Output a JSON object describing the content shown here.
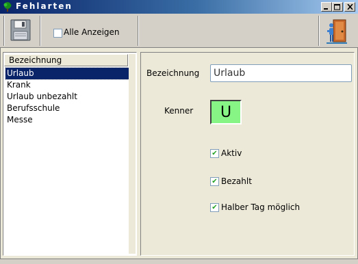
{
  "window": {
    "title": "Fehlarten"
  },
  "toolbar": {
    "save_icon": "floppy-disk-icon",
    "show_all_label": "Alle Anzeigen",
    "show_all_checked": false,
    "exit_icon": "exit-door-icon"
  },
  "list": {
    "header": "Bezeichnung",
    "items": [
      "Urlaub",
      "Krank",
      "Urlaub unbezahlt",
      "Berufsschule",
      "Messe"
    ],
    "selected": "Urlaub"
  },
  "detail": {
    "bezeichnung_label": "Bezeichnung",
    "bezeichnung_value": "Urlaub",
    "kenner_label": "Kenner",
    "kenner_value": "U",
    "kenner_color": "#86f586",
    "aktiv_label": "Aktiv",
    "aktiv_checked": true,
    "bezahlt_label": "Bezahlt",
    "bezahlt_checked": true,
    "halber_tag_label": "Halber Tag möglich",
    "halber_tag_checked": true
  },
  "colors": {
    "titlebar": "#0a246a",
    "selection": "#0a246a",
    "face": "#ece9d8"
  }
}
